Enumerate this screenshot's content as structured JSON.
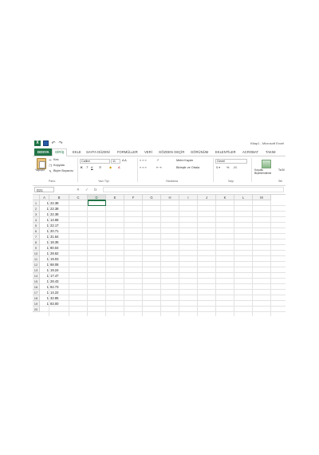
{
  "window": {
    "title": "Kitap1 - Microsoft Excel",
    "quick_access": {
      "undo": "↶",
      "redo": "↷"
    }
  },
  "tabs": [
    "DOSYA",
    "GİRİŞ",
    "EKLE",
    "SAYFA DÜZENİ",
    "FORMÜLLER",
    "VERİ",
    "GÖZDEN GEÇİR",
    "GÖRÜNÜM",
    "EKLENTİLER",
    "ACROBAT",
    "TAKIM"
  ],
  "active_tab": "GİRİŞ",
  "ribbon": {
    "clipboard": {
      "paste": "Yapıştır",
      "cut": "Kes",
      "copy": "Kopyala",
      "format_painter": "Biçim Boyacısı",
      "group": "Pano"
    },
    "font": {
      "name": "Calibri",
      "size": "11",
      "bold": "K",
      "italic": "T",
      "underline": "A",
      "group": "Yazı Tipi"
    },
    "alignment": {
      "wrap": "Metni Kaydır",
      "merge": "Birleştir ve Ortala",
      "group": "Hizalama"
    },
    "number": {
      "format": "Genel",
      "percent": "%",
      "group": "Sayı"
    },
    "styles": {
      "conditional": "Koşullu Biçimlendirme",
      "table": "Ta Bi",
      "group": "Stil"
    }
  },
  "formula_bar": {
    "name_box": "D21",
    "fx": "fx",
    "cancel": "✕",
    "enter": "✓",
    "value": ""
  },
  "columns": [
    "A",
    "B",
    "C",
    "D",
    "E",
    "F",
    "G",
    "H",
    "I",
    "J",
    "K",
    "L",
    "M"
  ],
  "selected_column": "D",
  "rows": [
    "1",
    "2",
    "3",
    "4",
    "5",
    "6",
    "7",
    "8",
    "9",
    "10",
    "11",
    "12",
    "13",
    "14",
    "15",
    "16",
    "17",
    "18",
    "19",
    "20"
  ],
  "cells": {
    "A": [
      "1",
      "1",
      "1",
      "1",
      "1",
      "1",
      "1",
      "1",
      "1",
      "1",
      "1",
      "1",
      "1",
      "1",
      "1",
      "1",
      "1",
      "1",
      "1"
    ],
    "B": [
      "22.38",
      "22.38",
      "22.38",
      "14.68",
      "22.17",
      "20.71",
      "31.64",
      "18.35",
      "80.04",
      "28.62",
      "19.03",
      "68.08",
      "19.24",
      "17.47",
      "28.43",
      "62.73",
      "14.22",
      "32.85",
      "83.00"
    ]
  },
  "icons": {
    "app": "excel-logo-icon",
    "save": "save-icon",
    "paste": "paste-icon",
    "cut": "scissors-icon",
    "copy": "copy-icon",
    "format_painter": "paintbrush-icon"
  }
}
